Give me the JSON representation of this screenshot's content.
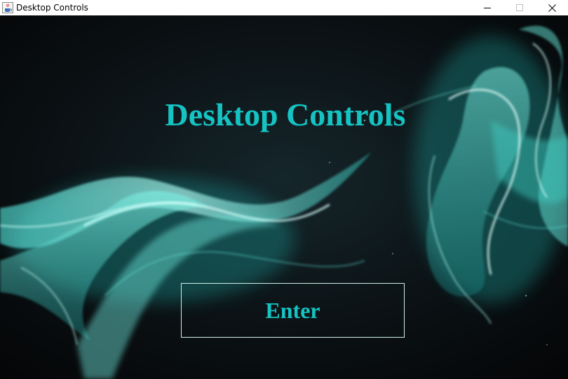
{
  "window": {
    "title": "Desktop Controls",
    "app_icon": "java-cup-icon",
    "controls": {
      "minimize_icon": "minimize-icon",
      "maximize_icon": "maximize-icon",
      "close_icon": "close-icon"
    }
  },
  "main": {
    "heading": "Desktop Controls",
    "enter_label": "Enter"
  },
  "colors": {
    "accent": "#15c3c3",
    "background": "#0a0c10",
    "button_border": "#cfeee9"
  }
}
